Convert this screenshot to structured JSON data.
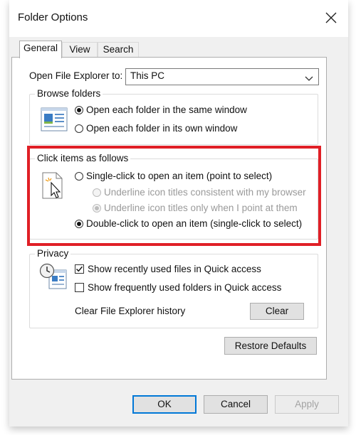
{
  "window": {
    "title": "Folder Options"
  },
  "tabs": [
    {
      "label": "General",
      "active": true
    },
    {
      "label": "View",
      "active": false
    },
    {
      "label": "Search",
      "active": false
    }
  ],
  "open_explorer": {
    "label": "Open File Explorer to:",
    "value": "This PC"
  },
  "browse_folders": {
    "legend": "Browse folders",
    "options": [
      {
        "label": "Open each folder in the same window",
        "checked": true
      },
      {
        "label": "Open each folder in its own window",
        "checked": false
      }
    ]
  },
  "click_items": {
    "legend": "Click items as follows",
    "single_click": {
      "label": "Single-click to open an item (point to select)",
      "checked": false
    },
    "underline_browser": {
      "label": "Underline icon titles consistent with my browser",
      "checked": false,
      "disabled": true
    },
    "underline_point": {
      "label": "Underline icon titles only when I point at them",
      "checked": true,
      "disabled": true
    },
    "double_click": {
      "label": "Double-click to open an item (single-click to select)",
      "checked": true
    }
  },
  "privacy": {
    "legend": "Privacy",
    "recent_files": {
      "label": "Show recently used files in Quick access",
      "checked": true
    },
    "frequent_folders": {
      "label": "Show frequently used folders in Quick access",
      "checked": false
    },
    "clear_history_label": "Clear File Explorer history",
    "clear_button": "Clear"
  },
  "restore_defaults": "Restore Defaults",
  "footer": {
    "ok": "OK",
    "cancel": "Cancel",
    "apply": "Apply"
  },
  "colors": {
    "highlight": "#e01f26",
    "accent": "#0078d7"
  }
}
